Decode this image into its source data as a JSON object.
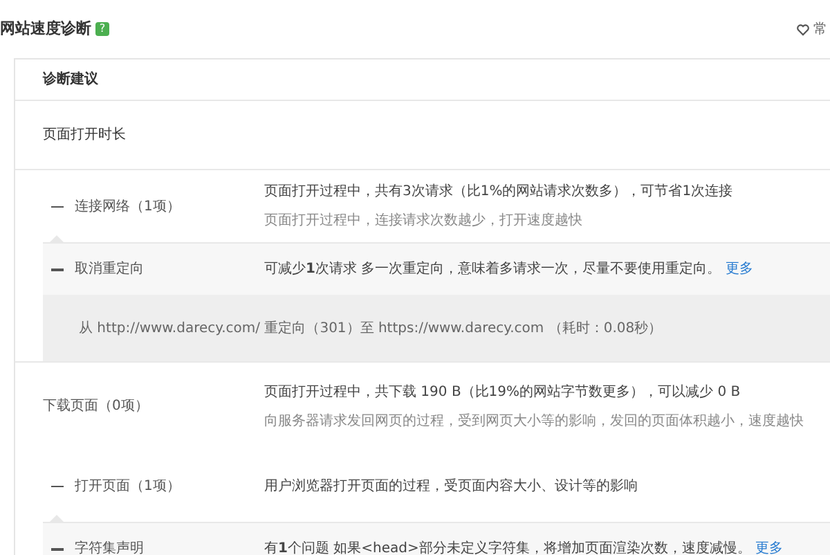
{
  "header": {
    "title": "网站速度诊断",
    "badge": "?",
    "favorite": "常"
  },
  "panel": {
    "heading": "诊断建议",
    "section_title": "页面打开时长"
  },
  "rows": [
    {
      "kind": "group",
      "expanded": true,
      "label": "连接网络（1项）",
      "summary": "页面打开过程中，共有3次请求（比1%的网站请求次数多），可节省1次连接",
      "note": "页面打开过程中，连接请求次数越少，打开速度越快"
    },
    {
      "kind": "item",
      "expanded": true,
      "label": "取消重定向",
      "summary": "可减少**1**次请求 多一次重定向，意味着多请求一次，尽量不要使用重定向。",
      "link": "更多",
      "detail": "从 http://www.darecy.com/ 重定向（301）至 https://www.darecy.com （耗时：0.08秒）"
    },
    {
      "kind": "plain",
      "label": "下载页面（0项）",
      "summary": "页面打开过程中，共下载 190 B（比19%的网站字节数更多），可以减少 0 B",
      "note": "向服务器请求发回网页的过程，受到网页大小等的影响，发回的页面体积越小，速度越快"
    },
    {
      "kind": "group",
      "expanded": true,
      "label": "打开页面（1项）",
      "summary": "用户浏览器打开页面的过程，受页面内容大小、设计等的影响"
    },
    {
      "kind": "item",
      "expanded": true,
      "label": "字符集声明",
      "summary": "有**1**个问题 如果<head>部分未定义字符集，将增加页面渲染次数，速度减慢。",
      "link": "更多"
    }
  ]
}
